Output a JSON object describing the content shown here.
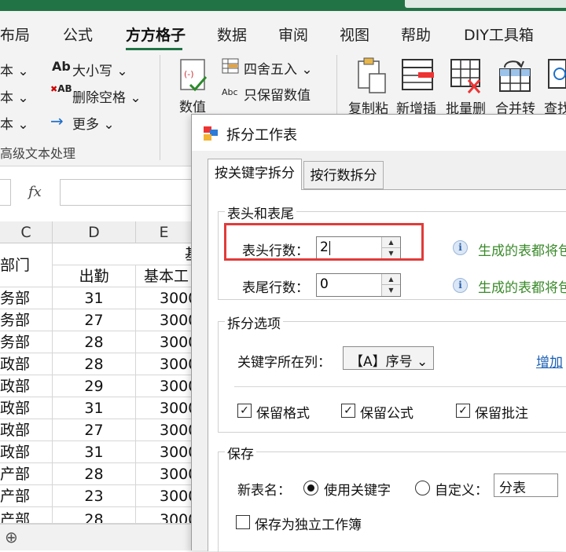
{
  "ribbon_tabs": {
    "t1": "布局",
    "t2": "公式",
    "t3": "方方格子",
    "t4": "数据",
    "t5": "审阅",
    "t6": "视图",
    "t7": "帮助",
    "t8": "DIY工具箱"
  },
  "ribbon": {
    "left_rows": [
      "本 ⌄",
      "本 ⌄",
      "本 ⌄"
    ],
    "case_label": "大小写 ⌄",
    "delete_space_label": "删除空格 ⌄",
    "more_label": "更多 ⌄",
    "group_label": "高级文本处理",
    "value_label": "数值",
    "round_label": "四舍五入 ⌄",
    "keep_values_label": "只保留数值",
    "copy_paste_label": "复制粘",
    "new_insert_label": "新增插",
    "batch_delete_label": "批量删",
    "merge_convert_label": "合并转",
    "find_label": "查找"
  },
  "formula_bar": {
    "fx": "fx"
  },
  "sheet": {
    "columns": [
      "C",
      "D",
      "E"
    ],
    "header_c": "部门",
    "header_d": "出勤",
    "header_e": "基本工",
    "header_e_top": "基",
    "rows": [
      [
        "务部",
        "31",
        "3000"
      ],
      [
        "务部",
        "27",
        "3000"
      ],
      [
        "务部",
        "28",
        "3000"
      ],
      [
        "政部",
        "28",
        "3000"
      ],
      [
        "政部",
        "29",
        "3000"
      ],
      [
        "政部",
        "31",
        "3000"
      ],
      [
        "政部",
        "27",
        "3000"
      ],
      [
        "政部",
        "31",
        "3000"
      ],
      [
        "产部",
        "28",
        "3000"
      ],
      [
        "产部",
        "23",
        "3000"
      ],
      [
        "产部",
        "28",
        "3000"
      ]
    ],
    "add_sheet": "⊕"
  },
  "dialog": {
    "title": "拆分工作表",
    "tab_keyword": "按关键字拆分",
    "tab_rows": "按行数拆分",
    "header_footer_group": "表头和表尾",
    "header_rows_label": "表头行数：",
    "header_rows_value": "2",
    "footer_rows_label": "表尾行数：",
    "footer_rows_value": "0",
    "info_text_1": "生成的表都将包",
    "info_text_2": "生成的表都将包",
    "split_options_group": "拆分选项",
    "keyword_col_label": "关键字所在列：",
    "keyword_col_value": "【A】序号 ⌄",
    "add_link": "增加",
    "keep_format": "保留格式",
    "keep_formula": "保留公式",
    "keep_comment": "保留批注",
    "save_group": "保存",
    "new_name_label": "新表名：",
    "use_keyword": "使用关键字",
    "custom_label": "自定义：",
    "custom_value": "分表",
    "save_independent": "保存为独立工作簿"
  },
  "colors": {
    "excel_green": "#217346",
    "highlight_red": "#e23a3a",
    "info_green": "#3a8a2a",
    "link_blue": "#1a5fb4"
  }
}
